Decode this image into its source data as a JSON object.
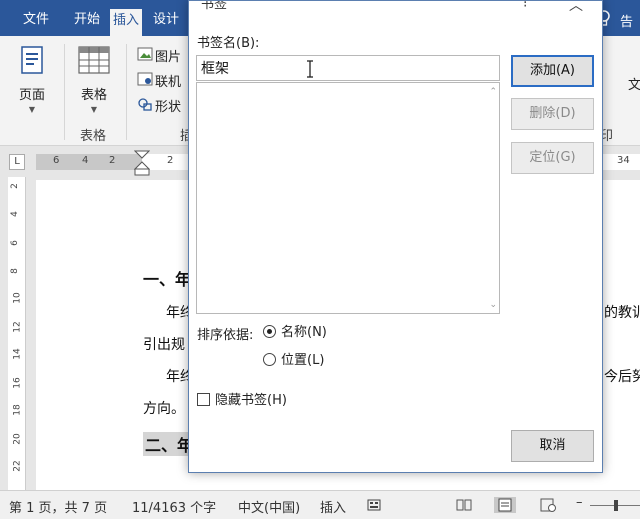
{
  "menu": {
    "tabs": [
      {
        "label": "文件"
      },
      {
        "label": "开始"
      },
      {
        "label": "插入"
      },
      {
        "label": "设计"
      }
    ],
    "user": "告"
  },
  "ribbon": {
    "page_btn": "页面",
    "table_btn": "表格",
    "table_group": "表格",
    "pictures": "图片",
    "online": "联机",
    "shapes": "形状",
    "group_partial": "插",
    "right_partial_1": "文",
    "right_partial_2": "印"
  },
  "ruler": {
    "h_numbers": [
      "6",
      "4",
      "2",
      "2",
      "34"
    ],
    "v_numbers": [
      "2",
      "4",
      "6",
      "8",
      "10",
      "12",
      "14",
      "16",
      "18",
      "20",
      "22"
    ],
    "corner": "L"
  },
  "document": {
    "h1": "一、年",
    "p1_start": "年终",
    "p1_end": "的教训，",
    "p2": "引出规",
    "p3_start": "年终",
    "p3_end": "今后努力",
    "p4": "方向。",
    "h2": "二、年"
  },
  "dialog": {
    "title": "书签",
    "name_label": "书签名(B):",
    "name_value": "框架",
    "add_btn": "添加(A)",
    "delete_btn": "删除(D)",
    "goto_btn": "定位(G)",
    "sort_label": "排序依据:",
    "sort_by_name": "名称(N)",
    "sort_by_location": "位置(L)",
    "hidden_label": "隐藏书签(H)",
    "cancel_btn": "取消"
  },
  "status": {
    "page": "第 1 页，共 7 页",
    "words": "11/4163 个字",
    "lang": "中文(中国)",
    "mode": "插入"
  },
  "colors": {
    "brand": "#2b579a",
    "primary_button_border": "#2b6cc4"
  }
}
